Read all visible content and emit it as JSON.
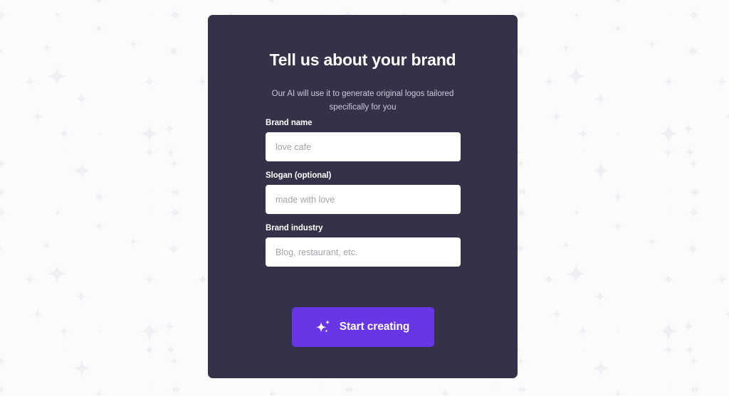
{
  "page": {
    "background_color": "#fbfbfc",
    "background_pattern": "sparkle-star-tile",
    "pattern_star_color": "#eef0f3"
  },
  "card": {
    "background_color": "#353148",
    "title": "Tell us about your brand",
    "subtitle": "Our AI will use it to generate original logos tailored specifically for you"
  },
  "form": {
    "fields": [
      {
        "name": "brand-name",
        "label": "Brand name",
        "placeholder": "love cafe",
        "value": ""
      },
      {
        "name": "slogan",
        "label": "Slogan (optional)",
        "placeholder": "made with love",
        "value": ""
      },
      {
        "name": "brand-industry",
        "label": "Brand industry",
        "placeholder": "Blog, restaurant, etc.",
        "value": ""
      }
    ]
  },
  "cta": {
    "label": "Start creating",
    "icon": "sparkles-icon",
    "background_color": "#6936e6",
    "text_color": "#ffffff"
  }
}
